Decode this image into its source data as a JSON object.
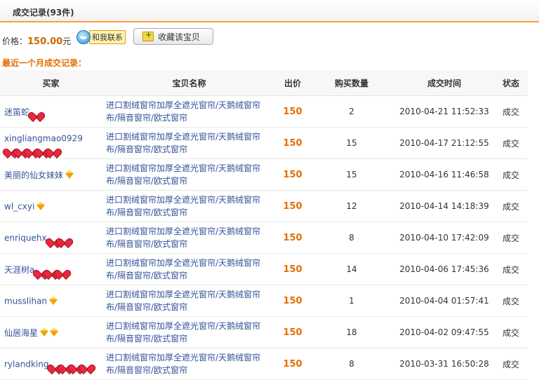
{
  "header": {
    "title": "成交记录(93件)"
  },
  "price": {
    "label": "价格：",
    "value": "150.00",
    "unit": "元"
  },
  "contact": {
    "label": "和我联系",
    "icon": "wangwang-icon"
  },
  "favorite_button": {
    "label": "收藏该宝贝",
    "icon": "favorite-add-icon"
  },
  "recent_title": "最近一个月成交记录：",
  "columns": [
    "买家",
    "宝贝名称",
    "出价",
    "购买数量",
    "成交时间",
    "状态"
  ],
  "rows": [
    {
      "buyer": "迷笛蛇",
      "badge": "heart",
      "badge_count": 1,
      "item_line1": "进口割绒窗帘加厚全遮光窗帘/天鹅绒窗帘",
      "item_line2": "布/隔音窗帘/欧式窗帘",
      "price": "150",
      "qty": "2",
      "time": "2010-04-21 11:52:33",
      "status": "成交"
    },
    {
      "buyer": "xingliangmao0929",
      "badge": "heart",
      "badge_count": 5,
      "buyer_wrap": true,
      "item_line1": "进口割绒窗帘加厚全遮光窗帘/天鹅绒窗帘",
      "item_line2": "布/隔音窗帘/欧式窗帘",
      "price": "150",
      "qty": "15",
      "time": "2010-04-17 21:12:55",
      "status": "成交"
    },
    {
      "buyer": "美丽的仙女妹妹",
      "badge": "diamond",
      "badge_count": 1,
      "item_line1": "进口割绒窗帘加厚全遮光窗帘/天鹅绒窗帘",
      "item_line2": "布/隔音窗帘/欧式窗帘",
      "price": "150",
      "qty": "15",
      "time": "2010-04-16 11:46:58",
      "status": "成交"
    },
    {
      "buyer": "wl_cxyi",
      "badge": "diamond",
      "badge_count": 1,
      "item_line1": "进口割绒窗帘加厚全遮光窗帘/天鹅绒窗帘",
      "item_line2": "布/隔音窗帘/欧式窗帘",
      "price": "150",
      "qty": "12",
      "time": "2010-04-14 14:18:39",
      "status": "成交"
    },
    {
      "buyer": "enriquehx",
      "badge": "heart",
      "badge_count": 2,
      "item_line1": "进口割绒窗帘加厚全遮光窗帘/天鹅绒窗帘",
      "item_line2": "布/隔音窗帘/欧式窗帘",
      "price": "150",
      "qty": "8",
      "time": "2010-04-10 17:42:09",
      "status": "成交"
    },
    {
      "buyer": "天涯树a",
      "badge": "heart",
      "badge_count": 3,
      "item_line1": "进口割绒窗帘加厚全遮光窗帘/天鹅绒窗帘",
      "item_line2": "布/隔音窗帘/欧式窗帘",
      "price": "150",
      "qty": "14",
      "time": "2010-04-06 17:45:36",
      "status": "成交"
    },
    {
      "buyer": "musslihan",
      "badge": "diamond",
      "badge_count": 1,
      "item_line1": "进口割绒窗帘加厚全遮光窗帘/天鹅绒窗帘",
      "item_line2": "布/隔音窗帘/欧式窗帘",
      "price": "150",
      "qty": "1",
      "time": "2010-04-04 01:57:41",
      "status": "成交"
    },
    {
      "buyer": "仙居海星",
      "badge": "diamond",
      "badge_count": 2,
      "item_line1": "进口割绒窗帘加厚全遮光窗帘/天鹅绒窗帘",
      "item_line2": "布/隔音窗帘/欧式窗帘",
      "price": "150",
      "qty": "18",
      "time": "2010-04-02 09:47:55",
      "status": "成交"
    },
    {
      "buyer": "rylandking",
      "badge": "heart",
      "badge_count": 4,
      "item_line1": "进口割绒窗帘加厚全遮光窗帘/天鹅绒窗帘",
      "item_line2": "布/隔音窗帘/欧式窗帘",
      "price": "150",
      "qty": "8",
      "time": "2010-03-31 16:50:28",
      "status": "成交"
    }
  ],
  "colors": {
    "accent": "#e46e00",
    "link": "#35529a",
    "header_border": "#ff9d3c",
    "heart": "#e8283c",
    "diamond": "#f2a000"
  }
}
